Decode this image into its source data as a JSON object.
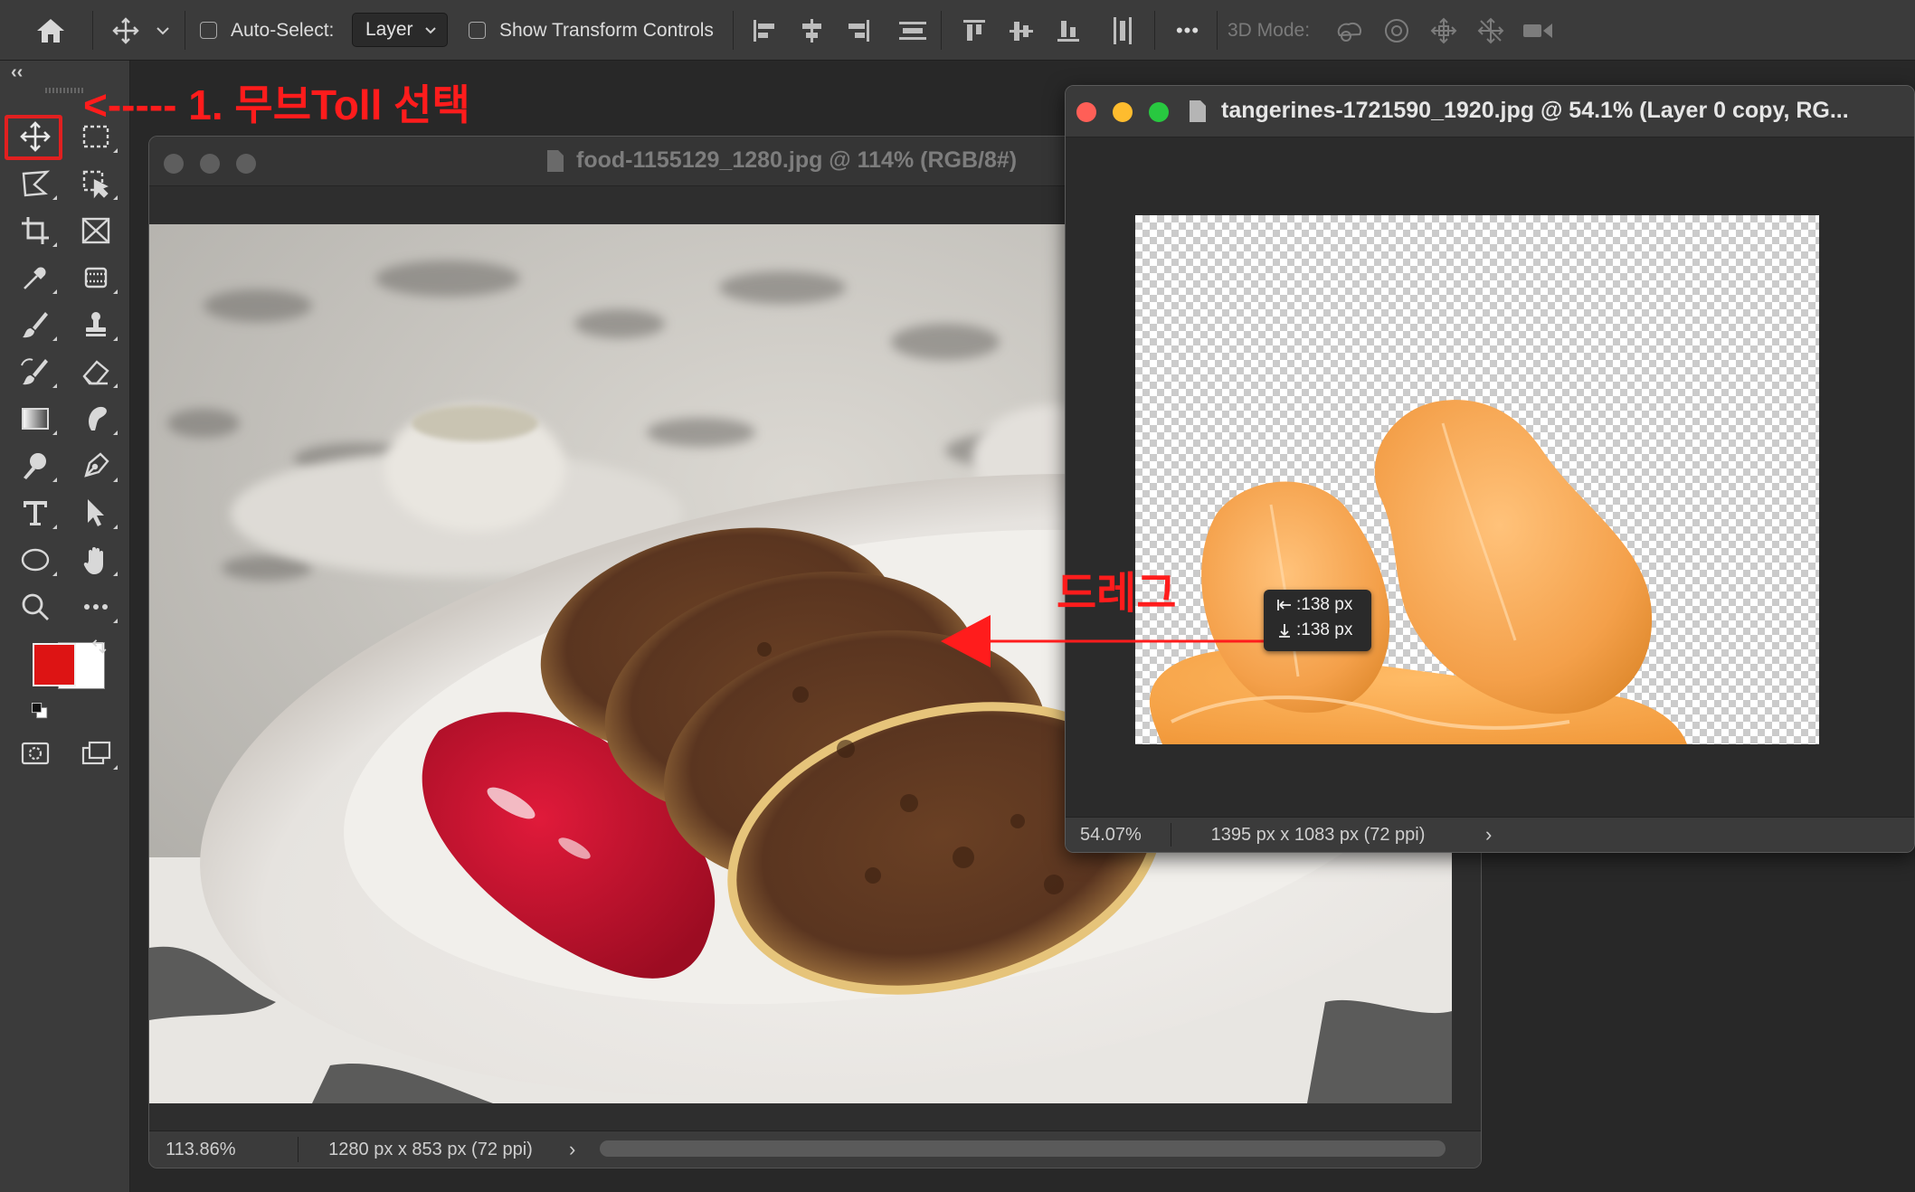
{
  "options_bar": {
    "auto_select_label": "Auto-Select:",
    "auto_select_value": "Layer",
    "show_transform_label": "Show Transform Controls",
    "three_d_mode_label": "3D Mode:",
    "more_label": "•••"
  },
  "tool_panel": {
    "collapse_label": "‹‹",
    "foreground_color": "#dd1414",
    "background_color": "#ffffff"
  },
  "annotations": {
    "step1": "<----- 1. 무브Toll 선택",
    "drag": "드레그",
    "color": "#ff1c1c"
  },
  "food_window": {
    "title": "food-1155129_1280.jpg @ 114% (RGB/8#)",
    "zoom": "113.86%",
    "doc_info": "1280 px x 853 px (72 ppi)",
    "arrow": "›"
  },
  "tangerine_window": {
    "title": "tangerines-1721590_1920.jpg @ 54.1% (Layer 0 copy, RG...",
    "zoom": "54.07%",
    "doc_info": "1395 px x 1083 px (72 ppi)",
    "arrow": "›"
  },
  "measure_tooltip": {
    "dx": ":138 px",
    "dy": ":138 px"
  }
}
